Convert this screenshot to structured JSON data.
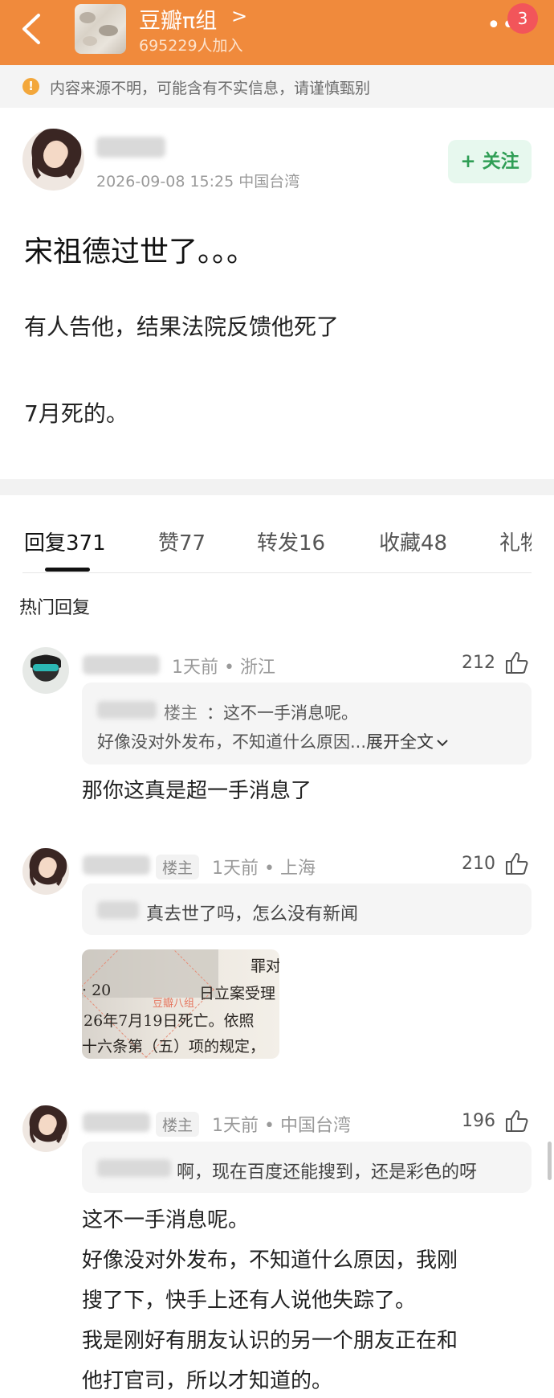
{
  "header": {
    "group_name": "豆瓣π组",
    "group_chevron": ">",
    "members": "695229人加入",
    "more": "••",
    "badge": "3"
  },
  "warning": {
    "text": "内容来源不明，可能含有不实信息，请谨慎甄别",
    "icon": "!"
  },
  "post": {
    "time_location": "2026-09-08 15:25  中国台湾",
    "follow_label": "+ 关注",
    "title": "宋祖德过世了。。。",
    "lines": [
      "有人告他，结果法院反馈他死了",
      "7月死的。"
    ]
  },
  "tabs": [
    {
      "label": "回复",
      "count": "371"
    },
    {
      "label": "赞",
      "count": "77"
    },
    {
      "label": "转发",
      "count": "16"
    },
    {
      "label": "收藏",
      "count": "48"
    },
    {
      "label": "礼物",
      "count": ""
    }
  ],
  "hot_label": "热门回复",
  "comments": [
    {
      "meta": "1天前 • 浙江",
      "likes": "212",
      "quote_tag": "楼主",
      "quote_line1": "：这不一手消息呢。",
      "quote_line2": "好像没对外发布，不知道什么原因...",
      "expand": "展开全文",
      "body": "那你这真是超一手消息了"
    },
    {
      "op_tag": "楼主",
      "meta": "1天前 • 上海",
      "likes": "210",
      "quote_line1": "真去世了吗，怎么没有新闻",
      "image_lines": [
        "罪对",
        "日立案受理",
        "26年7月19日死亡。依照",
        "十六条第（五）项的规定，",
        "· 20"
      ],
      "image_watermark": "豆瓣八组"
    },
    {
      "op_tag": "楼主",
      "meta": "1天前 • 中国台湾",
      "likes": "196",
      "quote_line1": "啊，现在百度还能搜到，还是彩色的呀",
      "body_lines": [
        "这不一手消息呢。",
        "好像没对外发布，不知道什么原因，我刚",
        "搜了下，快手上还有人说他失踪了。",
        "我是刚好有朋友认识的另一个朋友正在和",
        "他打官司，所以才知道的。"
      ]
    }
  ],
  "colors": {
    "brand_orange": "#f08a3c",
    "follow_green": "#2f9e55",
    "badge_red": "#f2555a"
  }
}
